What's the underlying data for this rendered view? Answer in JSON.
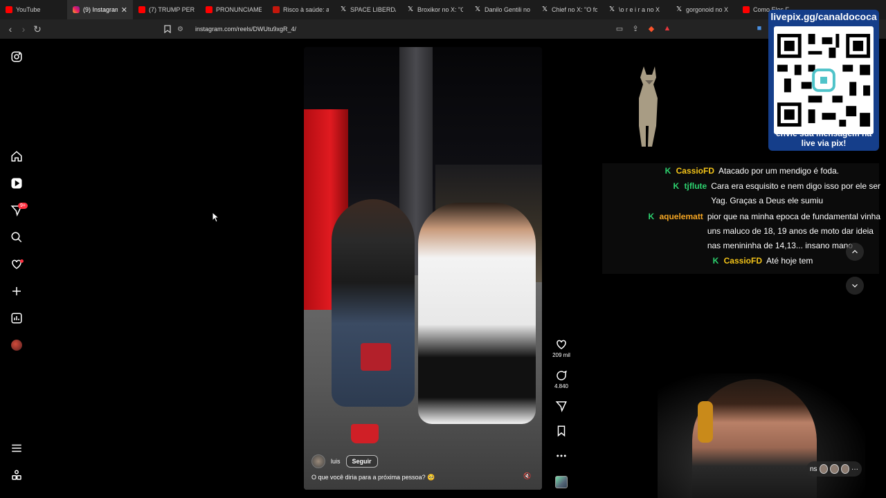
{
  "browser": {
    "tabs": [
      {
        "label": "YouTube",
        "icon": "youtube-icon"
      },
      {
        "label": "(9) Instagram",
        "icon": "instagram-icon",
        "active": true
      },
      {
        "label": "(7) TRUMP PERDE",
        "icon": "youtube-icon"
      },
      {
        "label": "PRONUNCIAMEN",
        "icon": "youtube-icon"
      },
      {
        "label": "Risco à saúde: an",
        "icon": "g1-icon"
      },
      {
        "label": "SPACE LIBERDADE",
        "icon": "x-icon"
      },
      {
        "label": "Broxikor no X: \"O",
        "icon": "x-icon"
      },
      {
        "label": "Danilo Gentili no",
        "icon": "x-icon"
      },
      {
        "label": "Chief no X: \"O fo",
        "icon": "x-icon"
      },
      {
        "label": "\\o r e i r a no X",
        "icon": "x-icon"
      },
      {
        "label": "gorgonoid no X",
        "icon": "x-icon"
      },
      {
        "label": "Como Eles F",
        "icon": "youtube-icon"
      }
    ],
    "url": "instagram.com/reels/DWUtu9xgR_4/"
  },
  "reel": {
    "author": "luis",
    "follow_label": "Seguir",
    "caption": "O que você diria para a próxima pessoa? 🥺",
    "likes": "209 mil",
    "comments": "4.840"
  },
  "sidebar": {
    "notification_badge": "9+"
  },
  "overlay": {
    "qr_header": "livepix.gg/canaldococa",
    "qr_footer_line1": "envie sua mensagem na",
    "qr_footer_line2": "live via pix!"
  },
  "chat": [
    {
      "user": "CassioFD",
      "user_color": "#f5c518",
      "message": "Atacado por um mendigo é foda."
    },
    {
      "user": "tjflute",
      "user_color": "#2dd36f",
      "message_line1": "Cara era esquisito e nem digo isso por ele ser",
      "message_line2": "Yag. Graças a Deus ele sumiu"
    },
    {
      "user": "aquelematt",
      "user_color": "#f5a623",
      "message_line1": "pior que na minha epoca de fundamental vinha",
      "message_line2": "uns maluco de 18, 19 anos de moto dar ideia",
      "message_line3": "nas menininha de 14,13... insano mano"
    },
    {
      "user": "CassioFD",
      "user_color": "#f5c518",
      "message": "Até hoje tem"
    }
  ],
  "webcam": {
    "pill_text": "ns"
  },
  "colors": {
    "page_bg": "#000000",
    "chat_k": "#2dd36f",
    "qr_panel": "#153e8a"
  }
}
